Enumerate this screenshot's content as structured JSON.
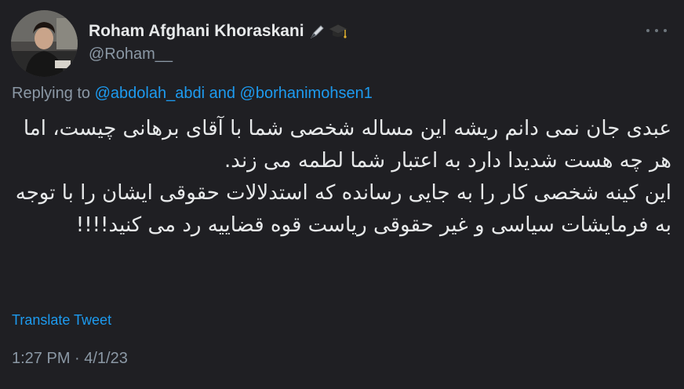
{
  "tweet": {
    "author_name": "Roham Afghani Khoraskani",
    "author_emojis": [
      "🖋",
      "🎓"
    ],
    "handle": "@Roham__",
    "replying_prefix": "Replying to ",
    "mention_1": "@abdolah_abdi",
    "mention_joiner": " and ",
    "mention_2": "@borhanimohsen1",
    "body": "عبدی جان نمی دانم ریشه این مساله شخصی شما با آقای برهانی چیست، اما هر چه هست شدیدا دارد به اعتبار شما لطمه می زند.\nاین کینه شخصی کار را به جایی رسانده که استدلالات حقوقی ایشان را با توجه به فرمایشات سیاسی و غیر حقوقی ریاست قوه قضاییه رد می کنید!!!!",
    "translate_label": "Translate Tweet",
    "timestamp": "1:27 PM · 4/1/23"
  },
  "icons": {
    "more": "more-horizontal-icon",
    "avatar": "profile-photo"
  },
  "colors": {
    "background": "#1f1f23",
    "text": "#e7e9ea",
    "secondary": "#8b98a5",
    "link": "#1d9bf0"
  }
}
